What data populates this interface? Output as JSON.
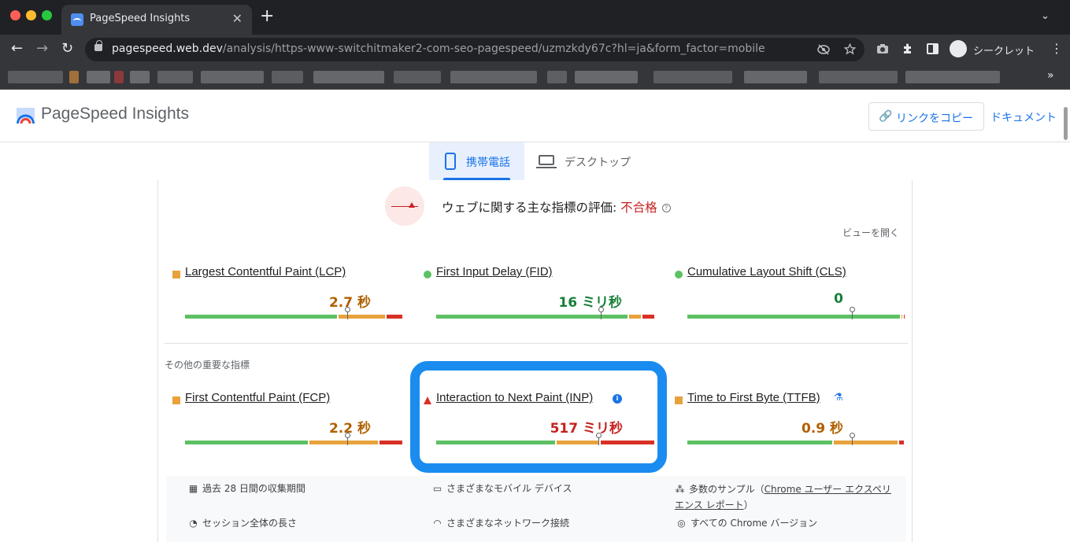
{
  "browser": {
    "tab_title": "PageSpeed Insights",
    "tab_close": "✕",
    "new_tab": "+",
    "tab_menu": "⌄",
    "url_host": "pagespeed.web.dev",
    "url_path": "/analysis/https-www-switchitmaker2-com-seo-pagespeed/uzmzkdy67c?hl=ja&form_factor=mobile",
    "incognito_label": "シークレット",
    "nav": {
      "back": "←",
      "forward": "→",
      "reload": "↻"
    },
    "icons": [
      "eye-off-icon",
      "star-icon",
      "camera-icon",
      "puzzle-icon",
      "sidepanel-icon",
      "incognito-icon",
      "kebab-icon"
    ],
    "more": "»"
  },
  "header": {
    "title": "PageSpeed Insights",
    "copy_link": "リンクをコピー",
    "docs": "ドキュメント"
  },
  "tabs": {
    "mobile": "携帯電話",
    "desktop": "デスクトップ"
  },
  "assessment": {
    "text": "ウェブに関する主な指標の評価: ",
    "status": "不合格",
    "help": "?",
    "expand": "ビューを開く"
  },
  "colors": {
    "accent": "#1a73e8",
    "good": "#5cc163",
    "needs_improvement": "#e8a23b",
    "poor": "#d93025",
    "highlight": "#1a8cf0"
  },
  "core_metrics": [
    {
      "name": "Largest Contentful Paint (LCP)",
      "value": "2.7 秒",
      "rating": "orange",
      "good": 0.7,
      "ni": 0.22,
      "poor": 0.08,
      "marker": 0.74
    },
    {
      "name": "First Input Delay (FID)",
      "value": "16 ミリ秒",
      "rating": "green",
      "good": 0.88,
      "ni": 0.06,
      "poor": 0.06,
      "marker": 0.75
    },
    {
      "name": "Cumulative Layout Shift (CLS)",
      "value": "0",
      "rating": "green",
      "good": 0.98,
      "ni": 0.01,
      "poor": 0.01,
      "marker": 0.75
    }
  ],
  "other_label": "その他の重要な指標",
  "other_metrics": [
    {
      "name": "First Contentful Paint (FCP)",
      "value": "2.2 秒",
      "rating": "orange",
      "good": 0.57,
      "ni": 0.32,
      "poor": 0.11,
      "marker": 0.74
    },
    {
      "name": "Interaction to Next Paint (INP)",
      "value": "517 ミリ秒",
      "rating": "red",
      "good": 0.55,
      "ni": 0.2,
      "poor": 0.25,
      "marker": 0.74,
      "badge": "info-icon",
      "info": "i"
    },
    {
      "name": "Time to First Byte (TTFB)",
      "value": "0.9 秒",
      "rating": "orange",
      "good": 0.67,
      "ni": 0.3,
      "poor": 0.03,
      "marker": 0.75,
      "badge": "flask-icon",
      "flask": "⚗"
    }
  ],
  "summary": {
    "period": "過去 28 日間の収集期間",
    "devices": "さまざまなモバイル デバイス",
    "samples_prefix": "多数のサンプル（",
    "samples_link_1": "Chrome ユーザー エクスペリ",
    "samples_link_2": "エンス レポート",
    "samples_suffix": "）",
    "session": "セッション全体の長さ",
    "network": "さまざまなネットワーク接続",
    "versions": "すべての Chrome バージョン"
  }
}
